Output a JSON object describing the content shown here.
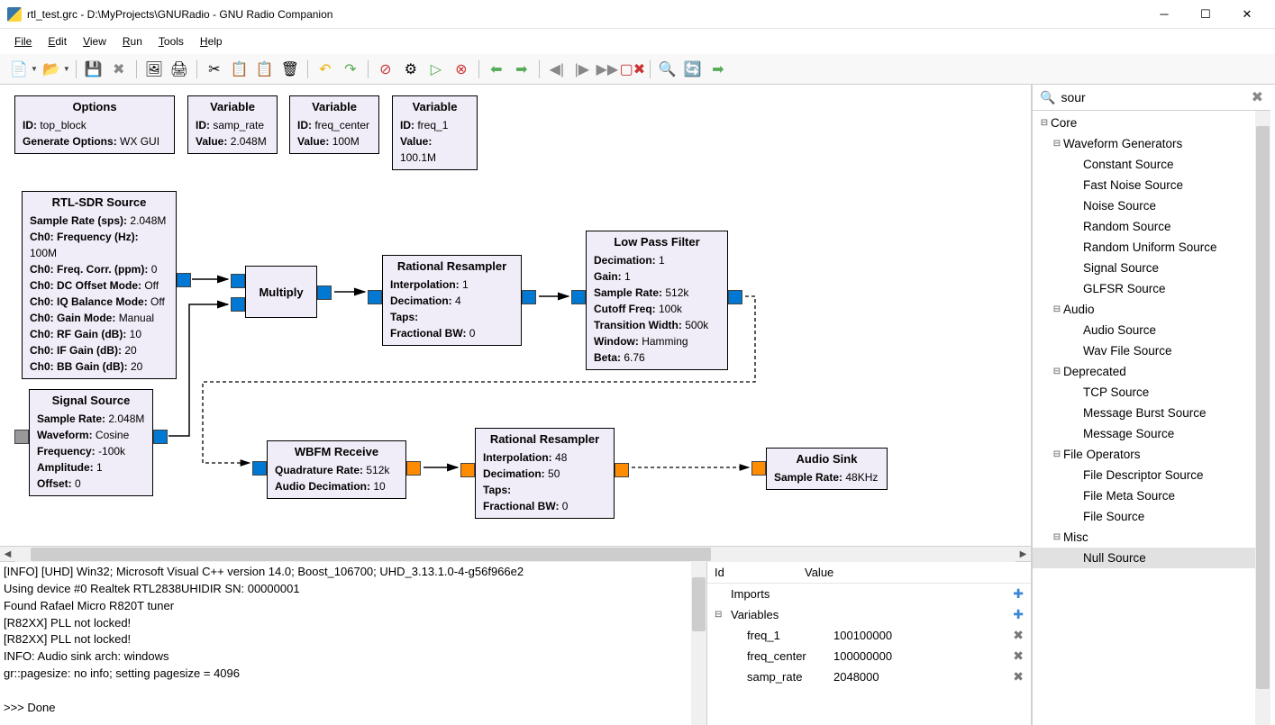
{
  "window": {
    "title": "rtl_test.grc - D:\\MyProjects\\GNURadio - GNU Radio Companion"
  },
  "menu": {
    "file": "File",
    "edit": "Edit",
    "view": "View",
    "run": "Run",
    "tools": "Tools",
    "help": "Help"
  },
  "blocks": {
    "options": {
      "title": "Options",
      "id_label": "ID:",
      "id": "top_block",
      "gen_label": "Generate Options:",
      "gen": "WX GUI"
    },
    "var1": {
      "title": "Variable",
      "id_label": "ID:",
      "id": "samp_rate",
      "val_label": "Value:",
      "val": "2.048M"
    },
    "var2": {
      "title": "Variable",
      "id_label": "ID:",
      "id": "freq_center",
      "val_label": "Value:",
      "val": "100M"
    },
    "var3": {
      "title": "Variable",
      "id_label": "ID:",
      "id": "freq_1",
      "val_label": "Value:",
      "val": "100.1M"
    },
    "rtl": {
      "title": "RTL-SDR Source",
      "rows": [
        [
          "Sample Rate (sps):",
          "2.048M"
        ],
        [
          "Ch0: Frequency (Hz):",
          "100M"
        ],
        [
          "Ch0: Freq. Corr. (ppm):",
          "0"
        ],
        [
          "Ch0: DC Offset Mode:",
          "Off"
        ],
        [
          "Ch0: IQ Balance Mode:",
          "Off"
        ],
        [
          "Ch0: Gain Mode:",
          "Manual"
        ],
        [
          "Ch0: RF Gain (dB):",
          "10"
        ],
        [
          "Ch0: IF Gain (dB):",
          "20"
        ],
        [
          "Ch0: BB Gain (dB):",
          "20"
        ]
      ]
    },
    "sigsrc": {
      "title": "Signal Source",
      "rows": [
        [
          "Sample Rate:",
          "2.048M"
        ],
        [
          "Waveform:",
          "Cosine"
        ],
        [
          "Frequency:",
          "-100k"
        ],
        [
          "Amplitude:",
          "1"
        ],
        [
          "Offset:",
          "0"
        ]
      ]
    },
    "multiply": {
      "title": "Multiply"
    },
    "rr1": {
      "title": "Rational Resampler",
      "rows": [
        [
          "Interpolation:",
          "1"
        ],
        [
          "Decimation:",
          "4"
        ],
        [
          "Taps:",
          ""
        ],
        [
          "Fractional BW:",
          "0"
        ]
      ]
    },
    "lpf": {
      "title": "Low Pass Filter",
      "rows": [
        [
          "Decimation:",
          "1"
        ],
        [
          "Gain:",
          "1"
        ],
        [
          "Sample Rate:",
          "512k"
        ],
        [
          "Cutoff Freq:",
          "100k"
        ],
        [
          "Transition Width:",
          "500k"
        ],
        [
          "Window:",
          "Hamming"
        ],
        [
          "Beta:",
          "6.76"
        ]
      ]
    },
    "wbfm": {
      "title": "WBFM Receive",
      "rows": [
        [
          "Quadrature Rate:",
          "512k"
        ],
        [
          "Audio Decimation:",
          "10"
        ]
      ]
    },
    "rr2": {
      "title": "Rational Resampler",
      "rows": [
        [
          "Interpolation:",
          "48"
        ],
        [
          "Decimation:",
          "50"
        ],
        [
          "Taps:",
          ""
        ],
        [
          "Fractional BW:",
          "0"
        ]
      ]
    },
    "sink": {
      "title": "Audio Sink",
      "rows": [
        [
          "Sample Rate:",
          "48KHz"
        ]
      ]
    }
  },
  "console": {
    "lines": [
      "[INFO] [UHD] Win32; Microsoft Visual C++ version 14.0; Boost_106700; UHD_3.13.1.0-4-g56f966e2",
      "Using device #0 Realtek RTL2838UHIDIR SN: 00000001",
      "Found Rafael Micro R820T tuner",
      "[R82XX] PLL not locked!",
      "[R82XX] PLL not locked!",
      "INFO: Audio sink arch: windows",
      "gr::pagesize: no info; setting pagesize = 4096",
      "",
      ">>> Done"
    ]
  },
  "varpanel": {
    "header_id": "Id",
    "header_val": "Value",
    "imports": "Imports",
    "variables": "Variables",
    "rows": [
      {
        "name": "freq_1",
        "value": "100100000"
      },
      {
        "name": "freq_center",
        "value": "100000000"
      },
      {
        "name": "samp_rate",
        "value": "2048000"
      }
    ]
  },
  "search": {
    "value": "sour"
  },
  "tree": {
    "root": "Core",
    "groups": [
      {
        "label": "Waveform Generators",
        "items": [
          "Constant Source",
          "Fast Noise Source",
          "Noise Source",
          "Random Source",
          "Random Uniform Source",
          "Signal Source",
          "GLFSR Source"
        ]
      },
      {
        "label": "Audio",
        "items": [
          "Audio Source",
          "Wav File Source"
        ]
      },
      {
        "label": "Deprecated",
        "items": [
          "TCP Source",
          "Message Burst Source",
          "Message Source"
        ]
      },
      {
        "label": "File Operators",
        "items": [
          "File Descriptor Source",
          "File Meta Source",
          "File Source"
        ]
      },
      {
        "label": "Misc",
        "items": [
          "Null Source"
        ]
      }
    ]
  }
}
